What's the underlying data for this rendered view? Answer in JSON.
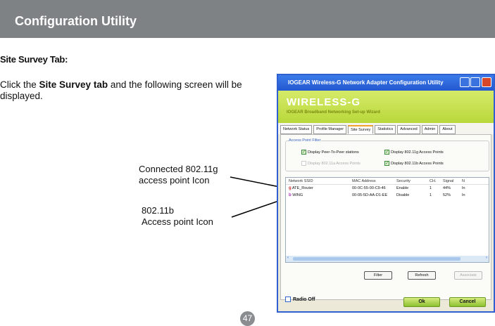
{
  "header": {
    "title": "Configuration Utility"
  },
  "section_title": "Site Survey Tab:",
  "paragraph": {
    "pre": "Click the ",
    "bold": "Site Survey tab",
    "post": " and the following screen will be displayed."
  },
  "callouts": {
    "g_icon": [
      "Connected 802.11g",
      "access point Icon"
    ],
    "b_icon": [
      "802.11b",
      "Access point Icon"
    ]
  },
  "page_number": "47",
  "app": {
    "title": "IOGEAR Wireless-G Network Adapter Configuration Utility",
    "logo": "WIRELESS-G",
    "subtitle": "IOGEAR Broadband Networking Set-up Wizard",
    "tabs": [
      "Network Status",
      "Profile Manager",
      "Site Survey",
      "Statistics",
      "Advanced",
      "Admin",
      "About"
    ],
    "filter": {
      "title": "Access Point Filter",
      "peer": "Display Peer-To-Peer stations",
      "a": "Display 802.11a Access Points",
      "g": "Display 802.11g Access Points",
      "b": "Display 802.11b Access Points"
    },
    "columns": [
      "Network SSID",
      "MAC Address",
      "Security",
      "CH.",
      "Signal",
      "N"
    ],
    "rows": [
      {
        "icon": "g",
        "ssid": "ATE_Router",
        "mac": "00-0C-55-00-C9-46",
        "security": "Enable",
        "ch": "1",
        "signal": "44%",
        "n": "In"
      },
      {
        "icon": "b",
        "ssid": "WING",
        "mac": "00-05-5D-AA-D1-EE",
        "security": "Disable",
        "ch": "1",
        "signal": "52%",
        "n": "In"
      }
    ],
    "buttons": {
      "filter": "Filter",
      "refresh": "Refresh",
      "associate": "Associate",
      "ok": "Ok",
      "cancel": "Cancel"
    },
    "radio_off": "Radio Off"
  }
}
